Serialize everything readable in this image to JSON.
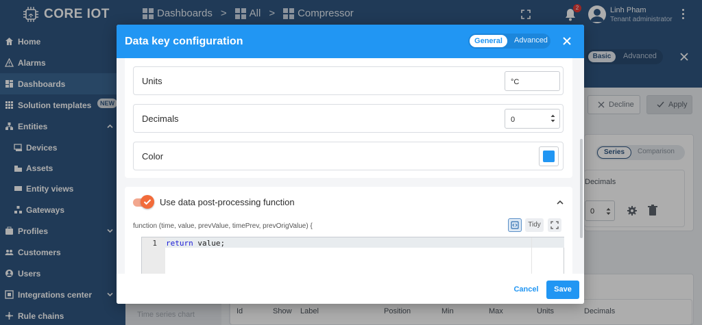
{
  "app": {
    "brand": "CORE IOT"
  },
  "breadcrumb": [
    "Dashboards",
    "All",
    "Compressor"
  ],
  "breadcrumb_sep": ">",
  "header": {
    "notification_count": "2",
    "user_name": "Linh Pham",
    "user_role": "Tenant administrator"
  },
  "sidebar": {
    "items": [
      {
        "label": "Home",
        "icon": "home-icon"
      },
      {
        "label": "Alarms",
        "icon": "warning-icon"
      },
      {
        "label": "Dashboards",
        "icon": "dashboard-icon",
        "active": true
      },
      {
        "label": "Solution templates",
        "icon": "apps-icon",
        "badge": "NEW"
      },
      {
        "label": "Entities",
        "icon": "entities-icon",
        "expanded": true
      },
      {
        "label": "Devices",
        "icon": "devices-icon"
      },
      {
        "label": "Assets",
        "icon": "assets-icon"
      },
      {
        "label": "Entity views",
        "icon": "entity-views-icon"
      },
      {
        "label": "Gateways",
        "icon": "gateways-icon"
      },
      {
        "label": "Profiles",
        "icon": "profiles-icon"
      },
      {
        "label": "Customers",
        "icon": "customers-icon"
      },
      {
        "label": "Users",
        "icon": "users-icon"
      },
      {
        "label": "Integrations center",
        "icon": "integrations-icon"
      },
      {
        "label": "Rule chains",
        "icon": "rule-chains-icon"
      }
    ]
  },
  "background": {
    "mode_on": "Basic",
    "mode_off": "Advanced",
    "decline": "Decline",
    "apply": "Apply",
    "series_on": "Series",
    "series_off": "Comparison",
    "decimals": "Decimals",
    "decimals_value": "0",
    "tschart": "Time series chart",
    "table_headers": [
      "Id",
      "Show",
      "Label",
      "Position",
      "Min",
      "Max",
      "Units",
      "Decimals"
    ]
  },
  "dialog": {
    "title": "Data key configuration",
    "tab_general": "General",
    "tab_advanced": "Advanced",
    "units_label": "Units",
    "units_value": "°C",
    "decimals_label": "Decimals",
    "decimals_value": "0",
    "color_label": "Color",
    "color_value": "#2196f3",
    "postprocess_label": "Use data post-processing function",
    "postprocess_enabled": true,
    "function_signature": "function (time, value, prevValue, timePrev, prevOrigValue) {",
    "tidy_label": "Tidy",
    "code_line_number": "1",
    "code_keyword": "return",
    "code_rest": " value;",
    "cancel": "Cancel",
    "save": "Save"
  }
}
